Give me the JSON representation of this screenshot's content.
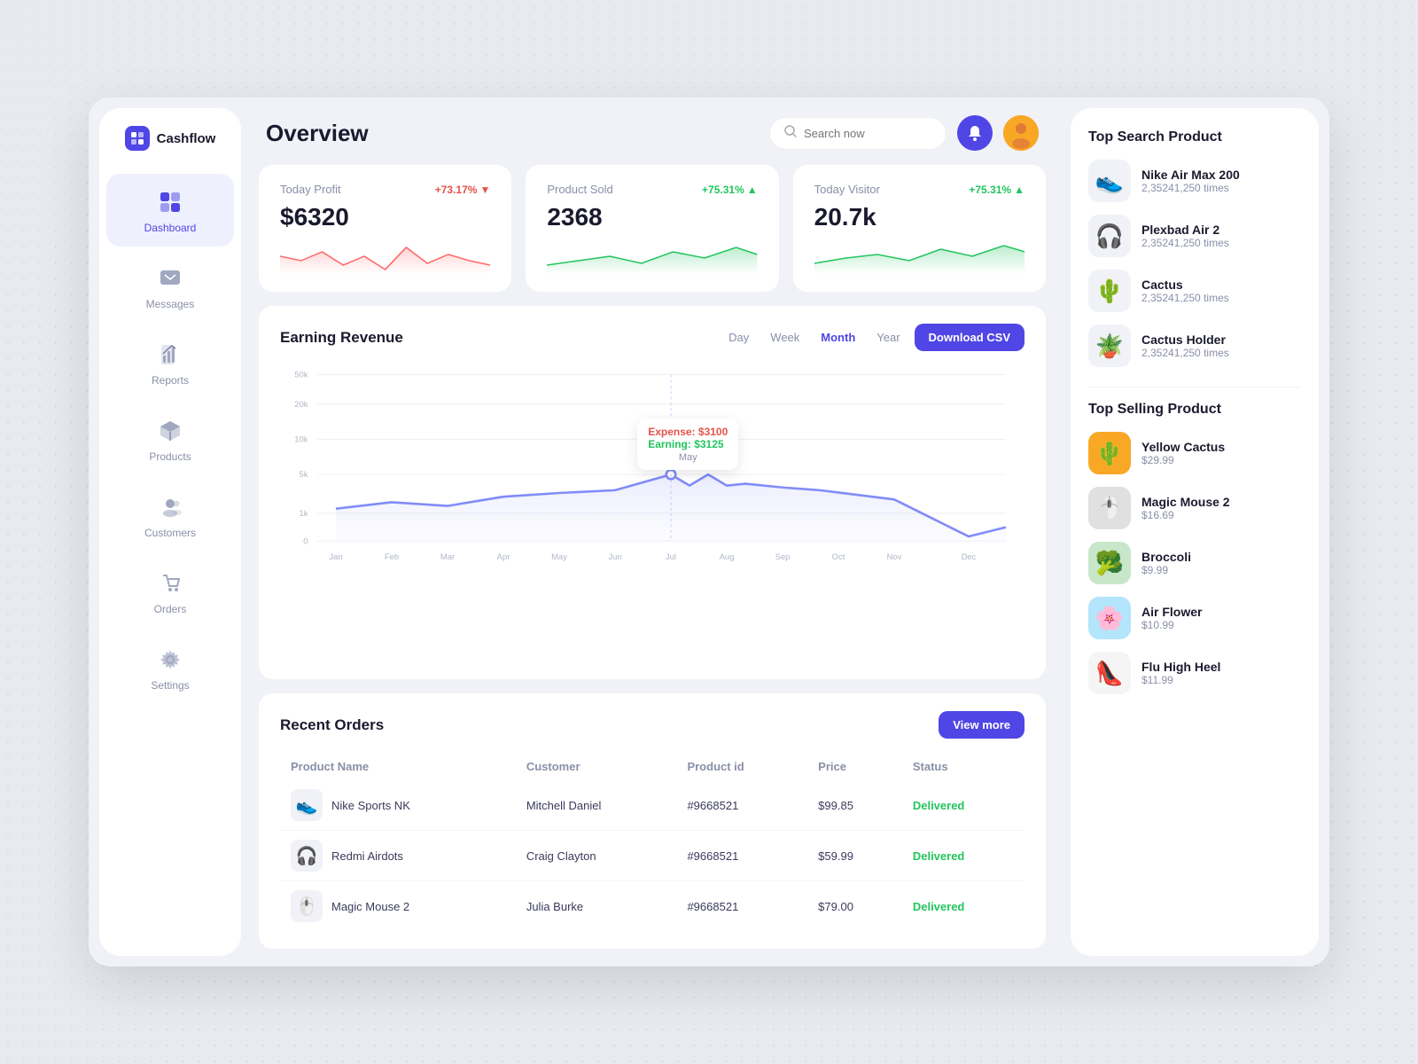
{
  "app": {
    "name": "Cashflow"
  },
  "header": {
    "title": "Overview",
    "search_placeholder": "Search now"
  },
  "sidebar": {
    "items": [
      {
        "id": "dashboard",
        "label": "Dashboard",
        "active": true
      },
      {
        "id": "messages",
        "label": "Messages",
        "active": false
      },
      {
        "id": "reports",
        "label": "Reports",
        "active": false
      },
      {
        "id": "products",
        "label": "Products",
        "active": false
      },
      {
        "id": "customers",
        "label": "Customers",
        "active": false
      },
      {
        "id": "orders",
        "label": "Orders",
        "active": false
      },
      {
        "id": "settings",
        "label": "Settings",
        "active": false
      }
    ]
  },
  "stats": {
    "today_profit": {
      "label": "Today Profit",
      "value": "$6320",
      "change": "+73.17%",
      "direction": "down",
      "type": "negative"
    },
    "product_sold": {
      "label": "Product Sold",
      "value": "2368",
      "change": "+75.31%",
      "direction": "up",
      "type": "positive"
    },
    "today_visitor": {
      "label": "Today Visitor",
      "value": "20.7k",
      "change": "+75.31%",
      "direction": "up",
      "type": "positive"
    }
  },
  "revenue_chart": {
    "title": "Earning Revenue",
    "periods": [
      "Day",
      "Week",
      "Month",
      "Year"
    ],
    "active_period": "Month",
    "download_btn": "Download CSV",
    "tooltip": {
      "expense_label": "Expense:",
      "expense_value": "$3100",
      "earning_label": "Earning:",
      "earning_value": "$3125",
      "month": "May"
    },
    "x_labels": [
      "Jan",
      "Feb",
      "Mar",
      "Apr",
      "May",
      "Jun",
      "Jul",
      "Aug",
      "Sep",
      "Oct",
      "Nov",
      "Dec"
    ],
    "y_labels": [
      "0",
      "1k",
      "5k",
      "10k",
      "20k",
      "50k"
    ]
  },
  "recent_orders": {
    "title": "Recent Orders",
    "view_more_btn": "View more",
    "columns": [
      "Product Name",
      "Customer",
      "Product id",
      "Price",
      "Status"
    ],
    "rows": [
      {
        "product": "Nike Sports NK",
        "customer": "Mitchell Daniel",
        "id": "#9668521",
        "price": "$99.85",
        "status": "Delivered",
        "emoji": "👟"
      },
      {
        "product": "Redmi Airdots",
        "customer": "Craig Clayton",
        "id": "#9668521",
        "price": "$59.99",
        "status": "Delivered",
        "emoji": "🎧"
      },
      {
        "product": "Magic Mouse 2",
        "customer": "Julia Burke",
        "id": "#9668521",
        "price": "$79.00",
        "status": "Delivered",
        "emoji": "🖱️"
      }
    ]
  },
  "top_search": {
    "title": "Top Search Product",
    "items": [
      {
        "name": "Nike Air Max 200",
        "times": "2,35241,250 times",
        "emoji": "👟"
      },
      {
        "name": "Plexbad Air 2",
        "times": "2,35241,250 times",
        "emoji": "🎧"
      },
      {
        "name": "Cactus",
        "times": "2,35241,250 times",
        "emoji": "🌵"
      },
      {
        "name": "Cactus Holder",
        "times": "2,35241,250 times",
        "emoji": "🪴"
      }
    ]
  },
  "top_selling": {
    "title": "Top Selling Product",
    "items": [
      {
        "name": "Yellow Cactus",
        "price": "$29.99",
        "emoji": "🌵",
        "bg": "#f9a825"
      },
      {
        "name": "Magic Mouse 2",
        "price": "$16.69",
        "emoji": "🖱️",
        "bg": "#e0e0e0"
      },
      {
        "name": "Broccoli",
        "price": "$9.99",
        "emoji": "🥦",
        "bg": "#c8e6c9"
      },
      {
        "name": "Air Flower",
        "price": "$10.99",
        "emoji": "🌸",
        "bg": "#b3e5fc"
      },
      {
        "name": "Flu High Heel",
        "price": "$11.99",
        "emoji": "👠",
        "bg": "#f5f5f5"
      }
    ]
  }
}
